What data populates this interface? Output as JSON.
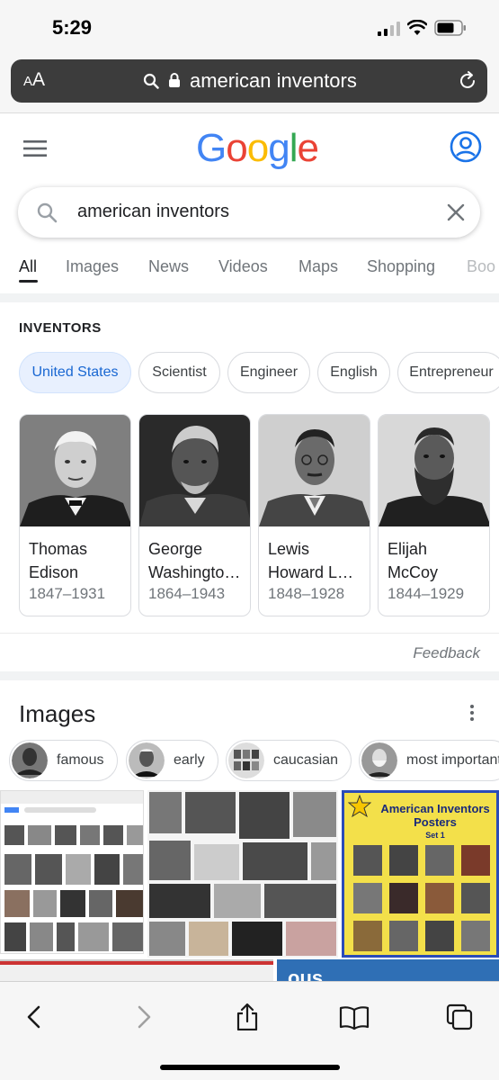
{
  "status_bar": {
    "time": "5:29"
  },
  "url_bar": {
    "aa_label_small": "A",
    "aa_label_large": "A",
    "url_text": "american inventors"
  },
  "google": {
    "logo_letters": [
      {
        "ch": "G",
        "color": "#4285F4"
      },
      {
        "ch": "o",
        "color": "#EA4335"
      },
      {
        "ch": "o",
        "color": "#FBBC05"
      },
      {
        "ch": "g",
        "color": "#4285F4"
      },
      {
        "ch": "l",
        "color": "#34A853"
      },
      {
        "ch": "e",
        "color": "#EA4335"
      }
    ],
    "search_query": "american inventors"
  },
  "tabs": [
    "All",
    "Images",
    "News",
    "Videos",
    "Maps",
    "Shopping",
    "Boo"
  ],
  "active_tab": "All",
  "inventors": {
    "heading": "INVENTORS",
    "filters": [
      "United States",
      "Scientist",
      "Engineer",
      "English",
      "Entrepreneur"
    ],
    "selected_filter": "United States",
    "people": [
      {
        "first": "Thomas",
        "last": "Edison",
        "years": "1847–1931"
      },
      {
        "first": "George",
        "last": "Washingto…",
        "years": "1864–1943"
      },
      {
        "first": "Lewis",
        "last": "Howard L…",
        "years": "1848–1928"
      },
      {
        "first": "Elijah",
        "last": "McCoy",
        "years": "1844–1929"
      }
    ],
    "feedback": "Feedback"
  },
  "images": {
    "heading": "Images",
    "chips": [
      "famous",
      "early",
      "caucasian",
      "most important"
    ],
    "poster_title": "American Inventors Posters",
    "poster_subtitle": "Set 1",
    "partial_text": "ous"
  },
  "colors": {
    "accent_blue": "#1a73e8",
    "selected_chip_bg": "#e8f0fe",
    "url_bar_bg": "#3c3c3c",
    "poster_bg": "#f3e04a",
    "poster_border": "#2a4bb8"
  }
}
